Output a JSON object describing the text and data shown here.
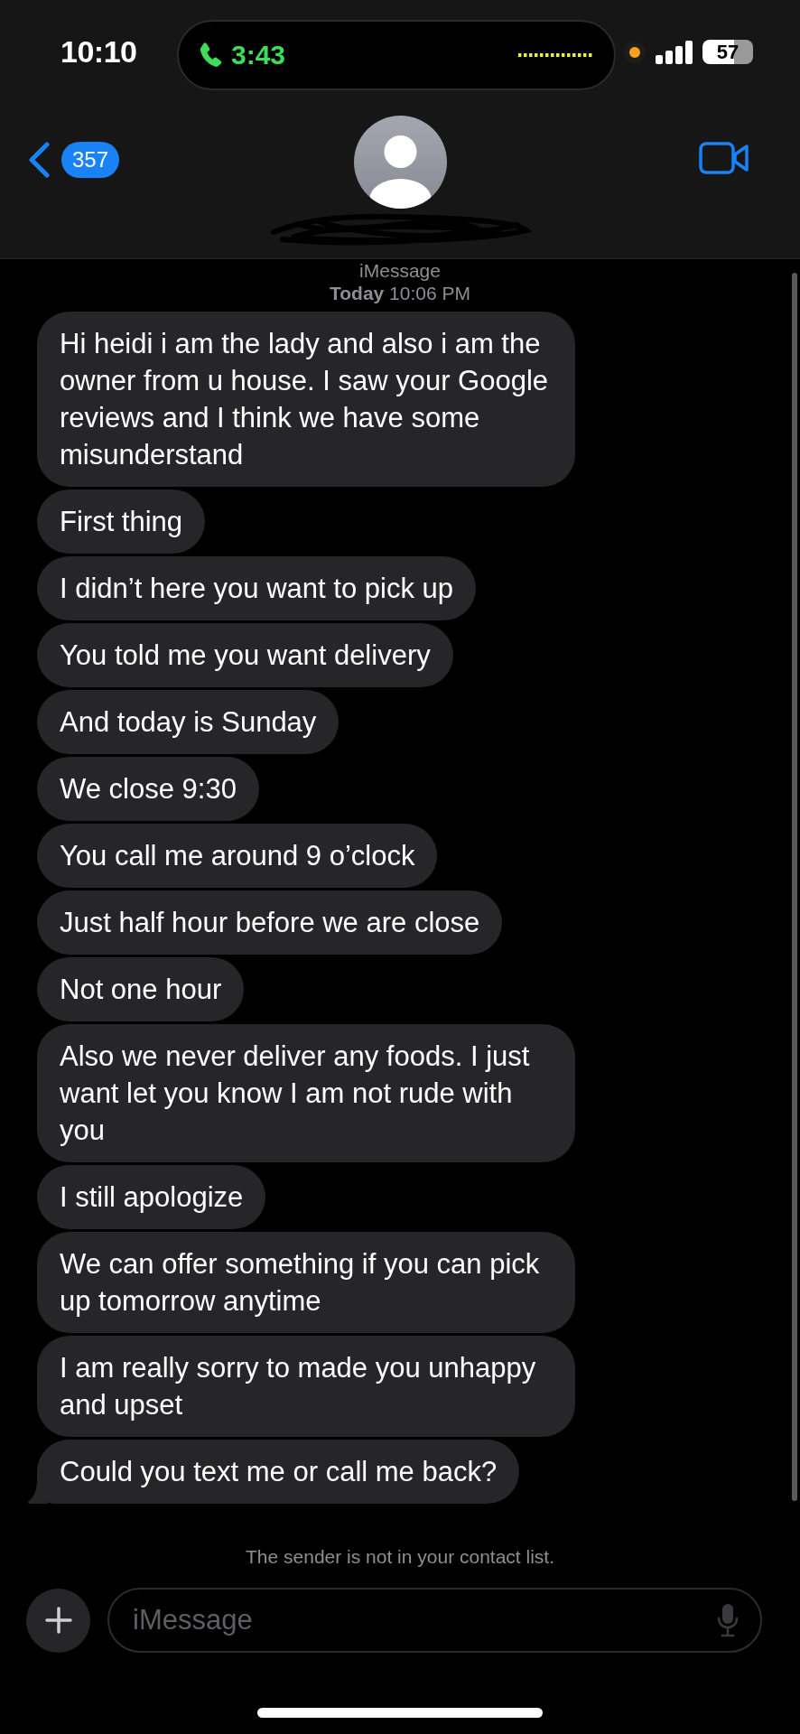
{
  "status_bar": {
    "time": "10:10",
    "call_duration": "3:43",
    "battery": "57"
  },
  "header": {
    "unread_count": "357"
  },
  "thread": {
    "service": "iMessage",
    "timestamp": "**Today** 10:06 PM"
  },
  "messages": [
    {
      "text": "Hi heidi i am the lady and also i am the owner from u house. I saw your Google reviews and I think we have some misunderstand",
      "tail": false
    },
    {
      "text": "First thing",
      "tail": false
    },
    {
      "text": "I didn’t here you want to pick up",
      "tail": false
    },
    {
      "text": "You told me you want delivery",
      "tail": false
    },
    {
      "text": "And today is Sunday",
      "tail": false
    },
    {
      "text": "We close 9:30",
      "tail": false
    },
    {
      "text": "You call me around 9 o’clock",
      "tail": false
    },
    {
      "text": "Just half hour before we are close",
      "tail": false
    },
    {
      "text": "Not one hour",
      "tail": false
    },
    {
      "text": "Also we never deliver any foods. I just want let you know I am not rude with you",
      "tail": false
    },
    {
      "text": "I still apologize",
      "tail": false
    },
    {
      "text": "We can offer something if you can pick up tomorrow anytime",
      "tail": false
    },
    {
      "text": "I am really sorry to made you unhappy and upset",
      "tail": false
    },
    {
      "text": "Could you text me or call me back?",
      "tail": true
    }
  ],
  "notice": "The sender is not in your contact list.",
  "composer": {
    "placeholder": "iMessage"
  }
}
